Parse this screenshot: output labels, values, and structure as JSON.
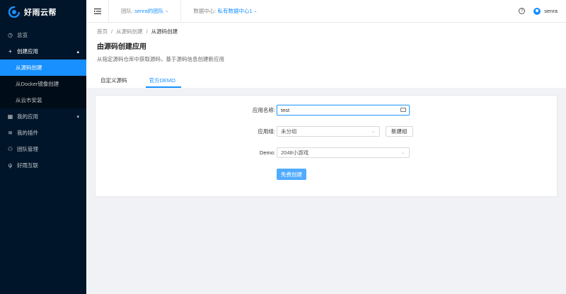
{
  "app": {
    "name": "好雨云帮"
  },
  "sidebar": {
    "items": [
      {
        "label": "总览",
        "icon": "dashboard-icon"
      },
      {
        "label": "创建应用",
        "icon": "plus-icon",
        "expanded": true,
        "children": [
          {
            "label": "从源码创建",
            "active": true
          },
          {
            "label": "从Docker镜像创建"
          },
          {
            "label": "从云市安装"
          }
        ]
      },
      {
        "label": "我的应用",
        "icon": "apps-icon"
      },
      {
        "label": "我的插件",
        "icon": "plugin-icon"
      },
      {
        "label": "团队管理",
        "icon": "team-icon"
      },
      {
        "label": "好雨互联",
        "icon": "connect-icon"
      }
    ]
  },
  "header": {
    "team_label": "团队:",
    "team_value": "senra的团队",
    "datacenter_label": "数据中心:",
    "datacenter_value": "私有数据中心1",
    "username": "senra"
  },
  "breadcrumb": [
    "首页",
    "从源码创建",
    "从源码创建"
  ],
  "page": {
    "title": "由源码创建应用",
    "description": "从指定源码仓库中获取源码，基于源码信息创建新应用"
  },
  "tabs": [
    {
      "label": "自定义源码",
      "active": false
    },
    {
      "label": "官方DEMO",
      "active": true
    }
  ],
  "form": {
    "app_name_label": "应用名称:",
    "app_name_value": "test",
    "app_group_label": "应用组:",
    "app_group_value": "未分组",
    "new_group_label": "新建组",
    "demo_label": "Demo:",
    "demo_value": "2048小游戏",
    "submit_label": "免费创建"
  },
  "colors": {
    "sidebar_bg": "#001529",
    "accent": "#1890ff"
  }
}
